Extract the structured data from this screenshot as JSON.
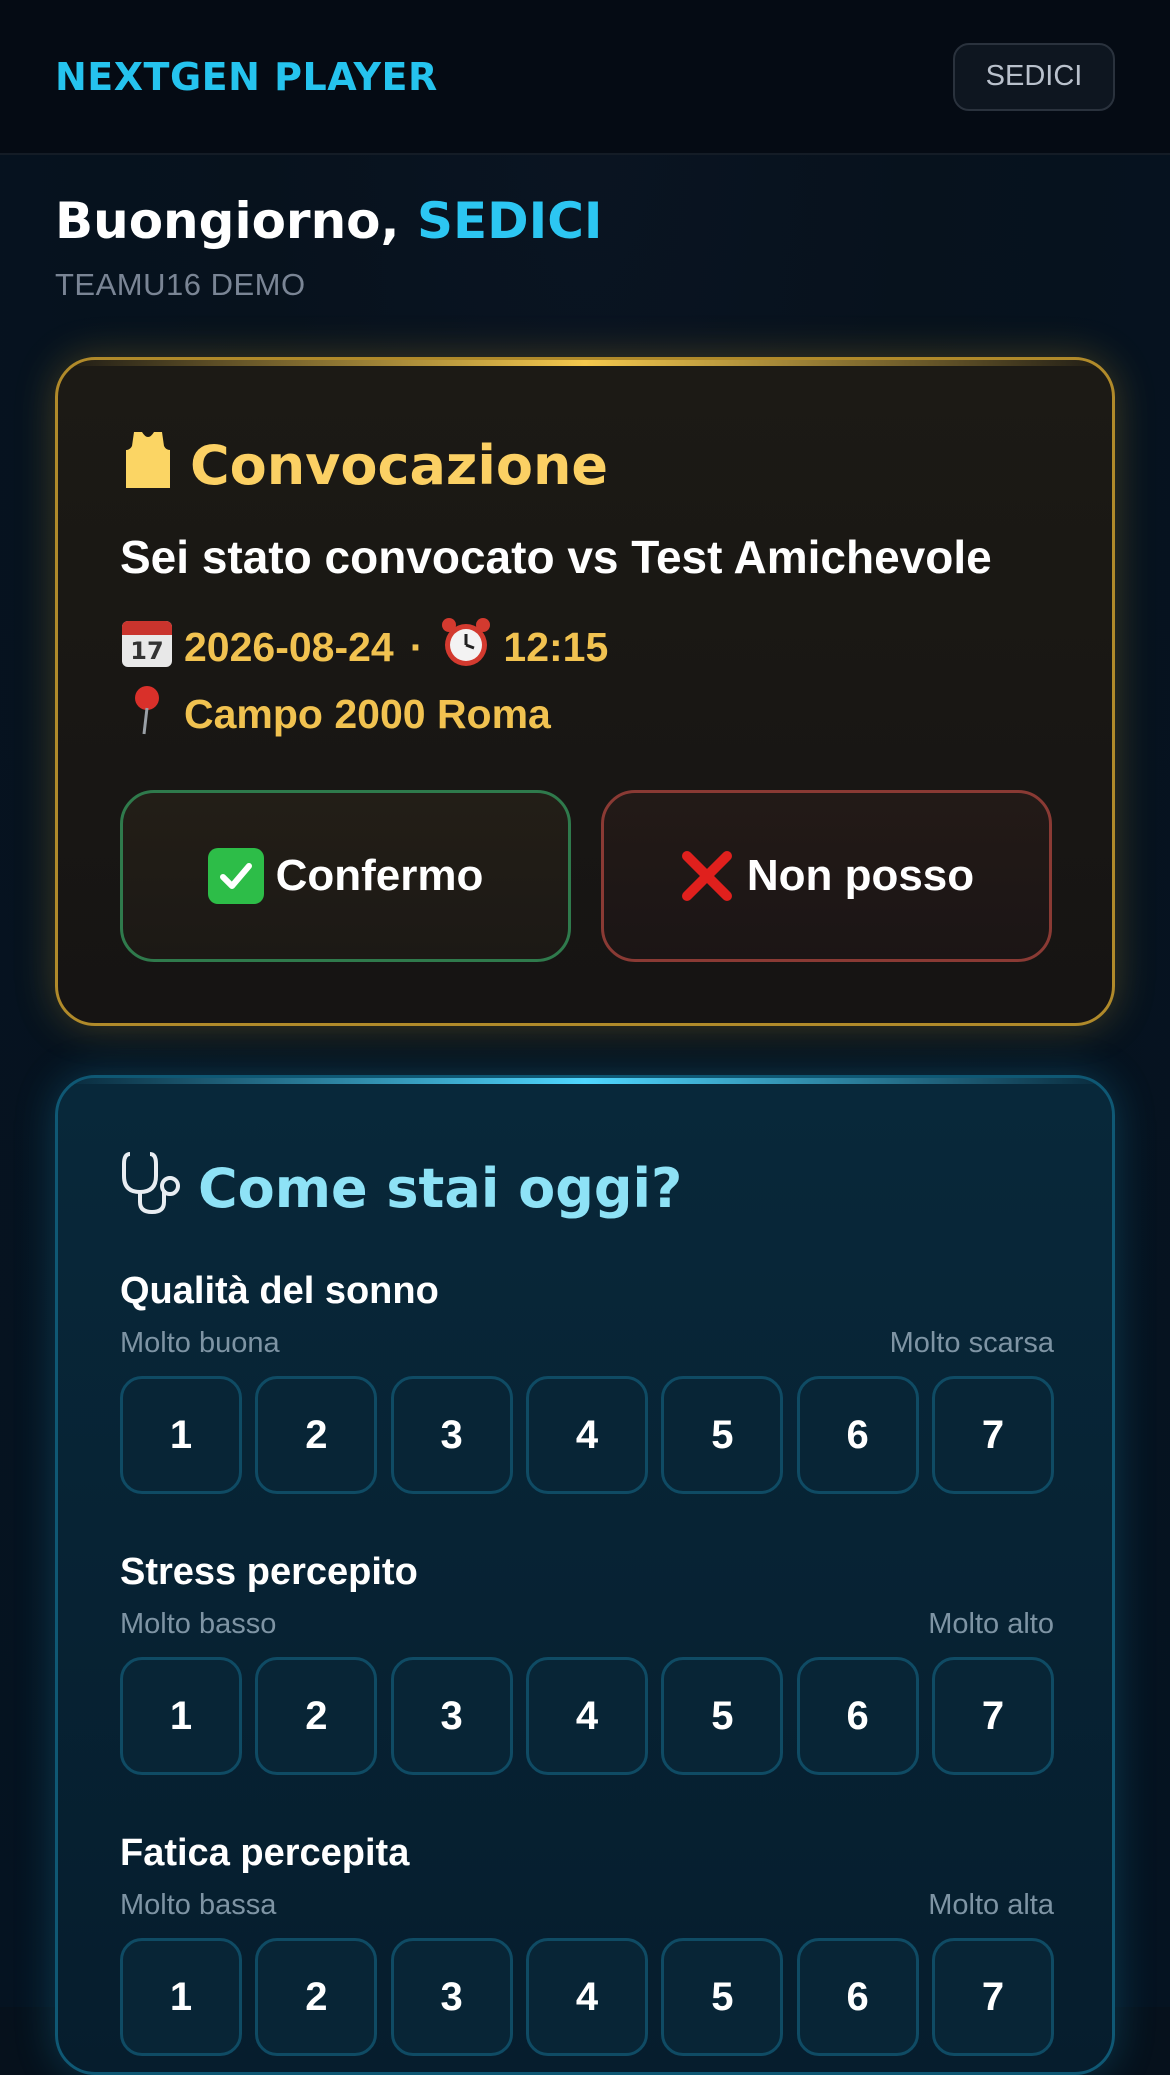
{
  "header": {
    "brand": "NEXTGEN PLAYER",
    "user_chip": "SEDICI"
  },
  "greeting": {
    "prefix": "Buongiorno,",
    "name": "SEDICI",
    "team": "TEAMU16 DEMO"
  },
  "convocazione": {
    "icon": "jersey-icon",
    "title": "Convocazione",
    "subtitle": "Sei stato convocato vs Test Amichevole",
    "date_icon": "calendar-icon",
    "date": "2026-08-24",
    "separator": "·",
    "time_icon": "alarm-clock-icon",
    "time": "12:15",
    "place_icon": "pin-icon",
    "place": "Campo 2000 Roma",
    "confirm_label": "Confermo",
    "decline_label": "Non posso",
    "colors": {
      "accent": "#fbd064",
      "confirm_border": "#2f7a4c",
      "decline_border": "#8a3a34"
    }
  },
  "wellness": {
    "icon": "stethoscope-icon",
    "title": "Come stai oggi?",
    "scales": [
      {
        "label": "Qualità del sonno",
        "low": "Molto buona",
        "high": "Molto scarsa",
        "options": [
          "1",
          "2",
          "3",
          "4",
          "5",
          "6",
          "7"
        ]
      },
      {
        "label": "Stress percepito",
        "low": "Molto basso",
        "high": "Molto alto",
        "options": [
          "1",
          "2",
          "3",
          "4",
          "5",
          "6",
          "7"
        ]
      },
      {
        "label": "Fatica percepita",
        "low": "Molto bassa",
        "high": "Molto alta",
        "options": [
          "1",
          "2",
          "3",
          "4",
          "5",
          "6",
          "7"
        ]
      }
    ],
    "colors": {
      "accent": "#8ee2f6",
      "border": "#0f5874"
    }
  }
}
